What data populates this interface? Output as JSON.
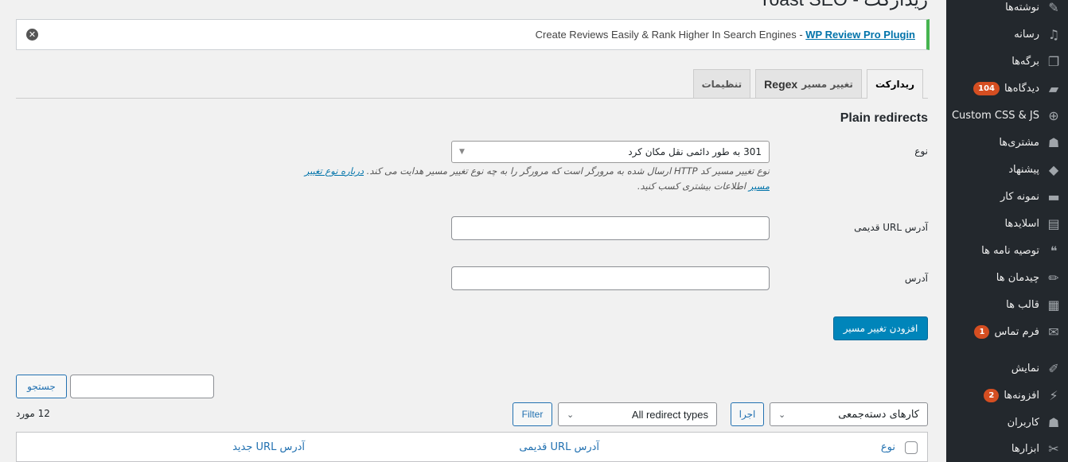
{
  "page": {
    "title": "ریدارکت - Yoast SEO"
  },
  "notice": {
    "text": "Create Reviews Easily & Rank Higher In Search Engines - ",
    "link": "WP Review Pro Plugin",
    "dismiss_icon": "dismiss-icon"
  },
  "tabs": [
    {
      "label": "ریدارکت",
      "active": true
    },
    {
      "label": "تغییر مسیر",
      "suffix": "Regex",
      "active": false
    },
    {
      "label": "تنظیمات",
      "active": false
    }
  ],
  "section": {
    "title": "Plain redirects"
  },
  "form": {
    "type_label": "نوع",
    "type_value": "301 به طور دائمی نقل مکان کرد",
    "help_text_1": "نوع تغییر مسیر کد HTTP ارسال شده به مرورگر است که مرورگر را به چه نوع تغییر مسیر هدایت می کند. ",
    "help_link": "درباره نوع تغییر مسیر",
    "help_text_2": " اطلاعات بیشتری کسب کنید.",
    "old_url_label": "آدرس URL قدیمی",
    "old_url_value": "",
    "url_label": "آدرس",
    "url_value": "",
    "submit_label": "افزودن تغییر مسیر"
  },
  "list": {
    "search_button": "جستجو",
    "search_value": "",
    "count": "12 مورد",
    "bulk_actions": "کارهای دسته‌جمعی",
    "apply_button": "اجرا",
    "type_filter": "All redirect types",
    "filter_button": "Filter",
    "columns": [
      "نوع",
      "آدرس URL قدیمی",
      "آدرس URL جدید"
    ]
  },
  "sidebar": {
    "items": [
      {
        "label": "نوشته‌ها",
        "icon": "pin-icon",
        "glyph": "✎"
      },
      {
        "label": "رسانه",
        "icon": "media-icon",
        "glyph": "♫"
      },
      {
        "label": "برگه‌ها",
        "icon": "pages-icon",
        "glyph": "❐"
      },
      {
        "label": "دیدگاه‌ها",
        "icon": "comments-icon",
        "glyph": "▰",
        "badge": "104"
      },
      {
        "label": "Custom CSS & JS",
        "icon": "plus-circle-icon",
        "glyph": "⊕"
      },
      {
        "label": "مشتری‌ها",
        "icon": "user-icon",
        "glyph": "☗"
      },
      {
        "label": "پیشنهاد",
        "icon": "tag-icon",
        "glyph": "◆"
      },
      {
        "label": "نمونه کار",
        "icon": "folder-icon",
        "glyph": "▬"
      },
      {
        "label": "اسلایدها",
        "icon": "slides-icon",
        "glyph": "▤"
      },
      {
        "label": "توصیه نامه ها",
        "icon": "quote-icon",
        "glyph": "❝"
      },
      {
        "label": "چیدمان ها",
        "icon": "pencil-icon",
        "glyph": "✏"
      },
      {
        "label": "قالب ها",
        "icon": "layout-icon",
        "glyph": "▦"
      },
      {
        "label": "فرم تماس",
        "icon": "mail-icon",
        "glyph": "✉",
        "badge": "1"
      },
      {
        "label": "نمایش",
        "icon": "brush-icon",
        "glyph": "✐"
      },
      {
        "label": "افزونه‌ها",
        "icon": "plugin-icon",
        "glyph": "⚡",
        "badge": "2"
      },
      {
        "label": "کاربران",
        "icon": "users-icon",
        "glyph": "☗"
      },
      {
        "label": "ابزارها",
        "icon": "wrench-icon",
        "glyph": "✂"
      }
    ]
  },
  "colors": {
    "sidebar_bg": "#23282d",
    "accent": "#0085ba",
    "badge": "#d54e21",
    "notice_border": "#46b450",
    "link": "#0073aa"
  }
}
